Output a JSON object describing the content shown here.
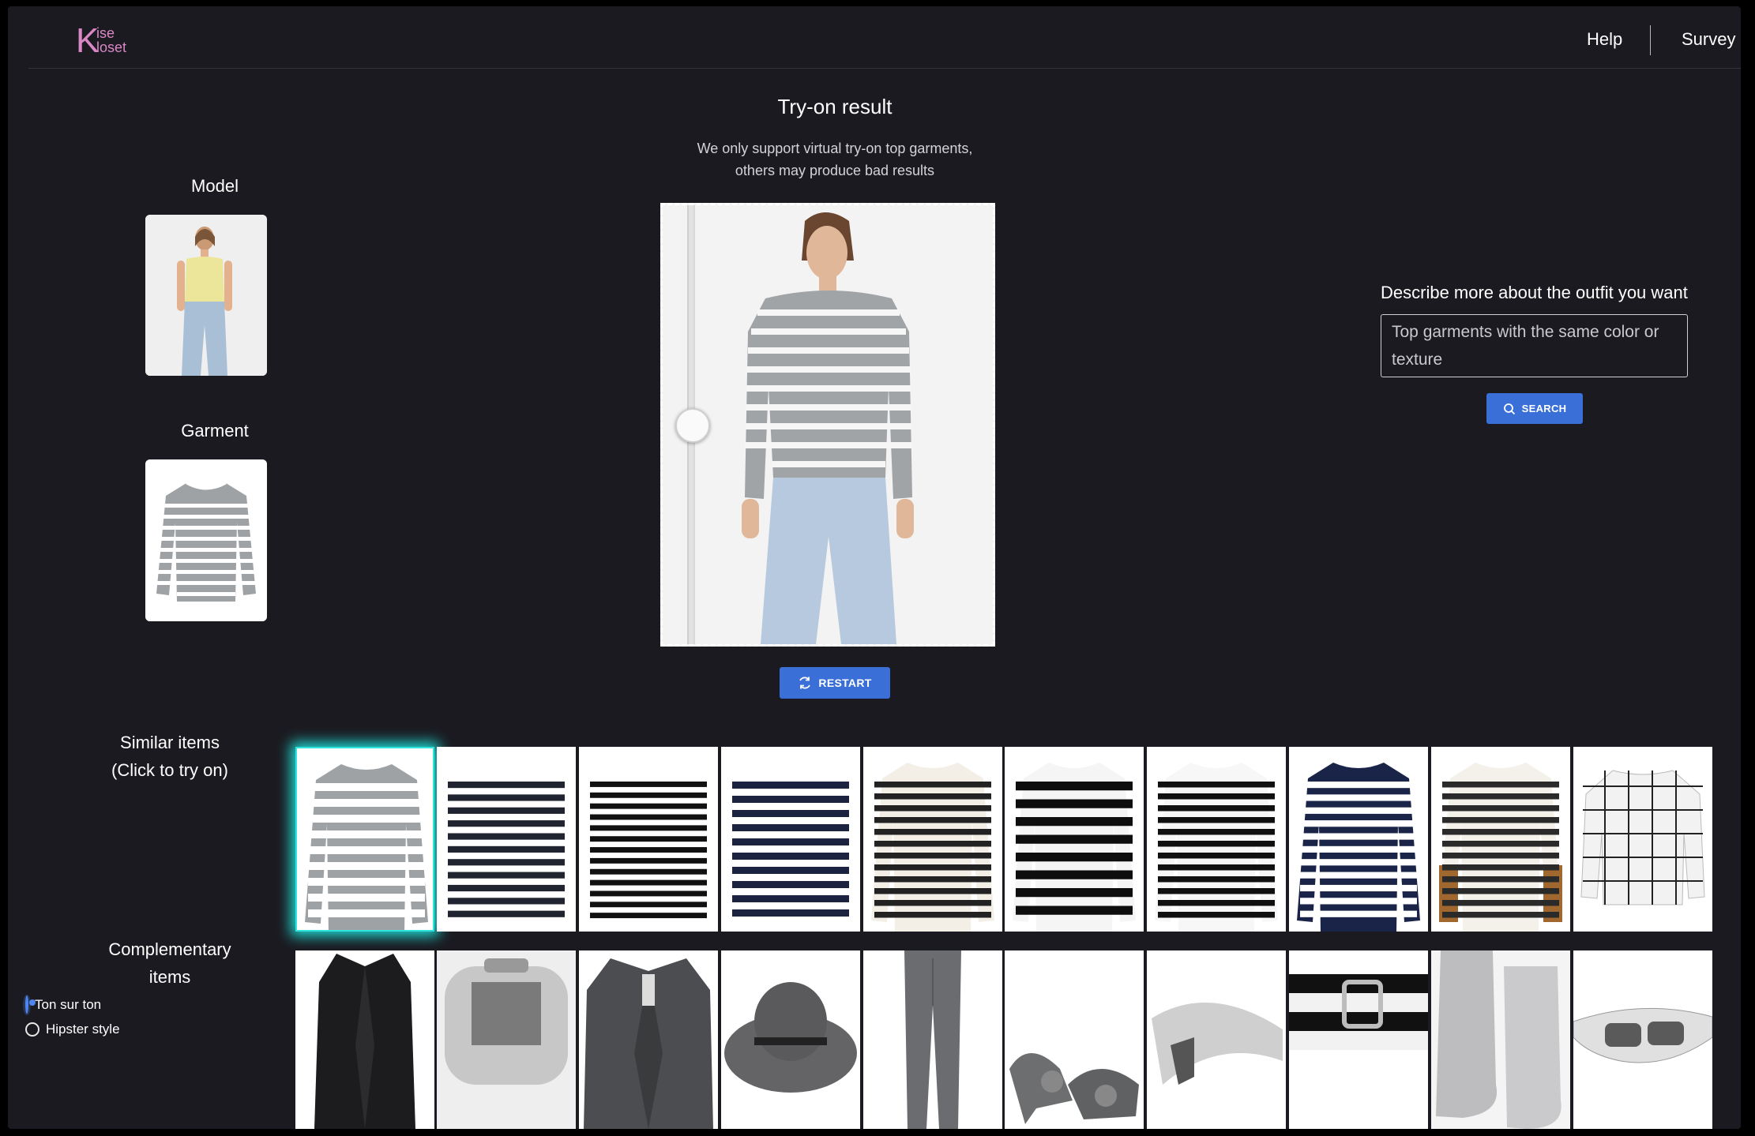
{
  "header": {
    "logo": {
      "big": "K",
      "top": "ise",
      "bottom": "loset"
    },
    "nav": {
      "help": "Help",
      "survey": "Survey"
    }
  },
  "left": {
    "model_title": "Model",
    "garment_title": "Garment"
  },
  "center": {
    "title": "Try-on result",
    "note_line1": "We only support virtual try-on top garments,",
    "note_line2": "others may produce bad results",
    "restart_label": "RESTART"
  },
  "right": {
    "describe_label": "Describe more about the outfit you want",
    "describe_placeholder": "Top garments with the same color or texture",
    "search_label": "SEARCH"
  },
  "similar": {
    "title_line1": "Similar items",
    "title_line2": "(Click to try on)",
    "items": [
      "grey-white stripe tee",
      "navy-white stripe tee",
      "black-white stripe tee",
      "white-navy stripe tee",
      "cream-black stripe tee",
      "bold black stripe tee",
      "black-white stripe tee",
      "navy-white stripe tee",
      "stripe tee with tan sleeves",
      "white grid check top"
    ]
  },
  "complementary": {
    "title_line1": "Complementary",
    "title_line2": "items",
    "options": [
      {
        "label": "Ton sur ton",
        "selected": true
      },
      {
        "label": "Hipster style",
        "selected": false
      }
    ],
    "items": [
      "black blazer",
      "silver clutch",
      "grey check blazer",
      "grey felt hat",
      "grey trousers",
      "grey pumps",
      "silver loafer",
      "striped belt",
      "silver ankle boots",
      "silver sunglasses"
    ]
  },
  "colors": {
    "background": "#1b1a20",
    "accent": "#3a6fd8",
    "logo": "#d988c6",
    "highlight": "#2ee4dc"
  }
}
